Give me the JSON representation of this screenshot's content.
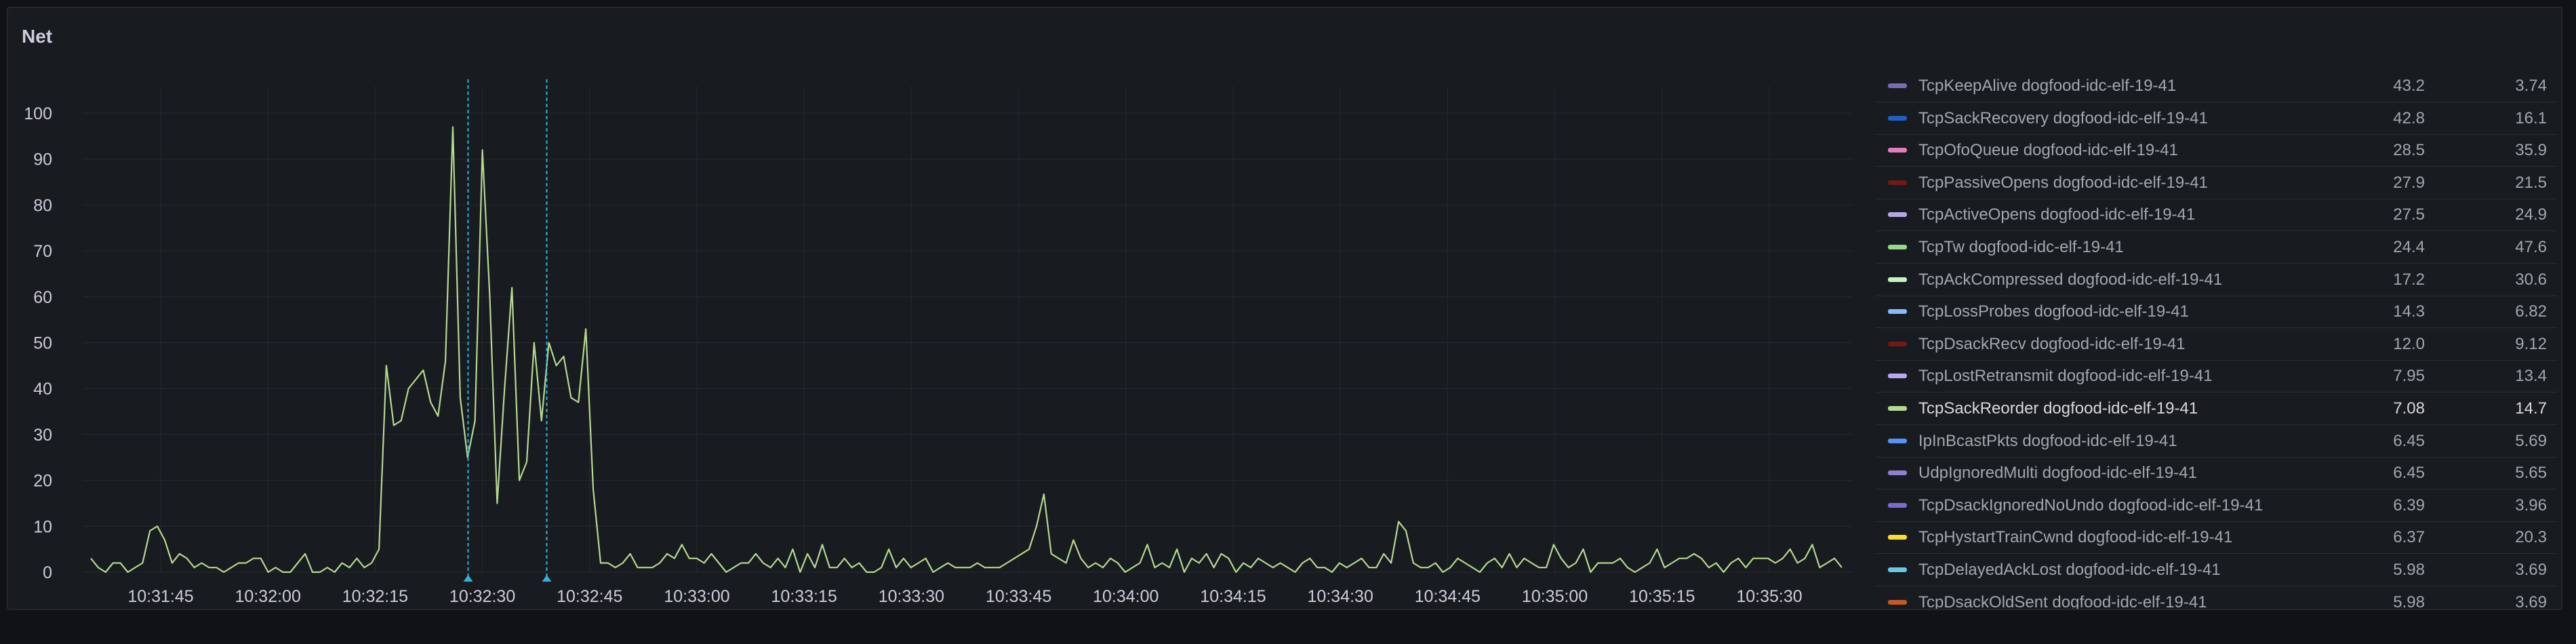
{
  "panel": {
    "title": "Net"
  },
  "chart_data": {
    "type": "line",
    "ylim": [
      0,
      100
    ],
    "yticks": [
      "100",
      "90",
      "80",
      "70",
      "60",
      "50",
      "40",
      "30",
      "20",
      "10",
      "0"
    ],
    "xticks": [
      "10:31:45",
      "10:32:00",
      "10:32:15",
      "10:32:30",
      "10:32:45",
      "10:33:00",
      "10:33:15",
      "10:33:30",
      "10:33:45",
      "10:34:00",
      "10:34:15",
      "10:34:30",
      "10:34:45",
      "10:35:00",
      "10:35:15",
      "10:35:30"
    ],
    "grid": true,
    "annotation_markers": [
      "10:32:28",
      "10:32:39"
    ],
    "series": [
      {
        "name": "TcpSackReorder dogfood-idc-elf-19-41",
        "color": "#b5d991",
        "values": [
          3,
          1,
          0,
          2,
          2,
          0,
          1,
          2,
          9,
          10,
          7,
          2,
          4,
          3,
          1,
          2,
          1,
          1,
          0,
          1,
          2,
          2,
          3,
          3,
          0,
          1,
          0,
          0,
          2,
          4,
          0,
          0,
          1,
          0,
          2,
          1,
          3,
          1,
          2,
          5,
          45,
          32,
          33,
          40,
          42,
          44,
          37,
          34,
          46,
          97,
          38,
          25,
          33,
          92,
          60,
          15,
          40,
          62,
          20,
          24,
          50,
          33,
          50,
          45,
          47,
          38,
          37,
          53,
          18,
          2,
          2,
          1,
          2,
          4,
          1,
          1,
          1,
          2,
          4,
          3,
          6,
          3,
          3,
          2,
          4,
          2,
          0,
          1,
          2,
          2,
          4,
          2,
          1,
          3,
          1,
          5,
          0,
          4,
          1,
          6,
          1,
          1,
          3,
          1,
          2,
          0,
          0,
          1,
          5,
          1,
          3,
          1,
          2,
          3,
          0,
          1,
          2,
          1,
          1,
          1,
          2,
          1,
          1,
          1,
          2,
          3,
          4,
          5,
          10,
          17,
          4,
          3,
          2,
          7,
          3,
          1,
          2,
          1,
          3,
          2,
          0,
          1,
          2,
          6,
          1,
          2,
          1,
          5,
          0,
          3,
          2,
          4,
          1,
          4,
          3,
          0,
          2,
          1,
          3,
          2,
          1,
          2,
          1,
          0,
          2,
          3,
          1,
          1,
          0,
          2,
          1,
          2,
          3,
          1,
          1,
          4,
          2,
          11,
          9,
          2,
          1,
          1,
          2,
          0,
          1,
          3,
          2,
          1,
          0,
          2,
          3,
          1,
          4,
          1,
          3,
          2,
          1,
          1,
          6,
          3,
          1,
          2,
          5,
          0,
          2,
          2,
          2,
          3,
          1,
          0,
          1,
          2,
          5,
          1,
          2,
          3,
          3,
          4,
          3,
          1,
          2,
          0,
          2,
          3,
          1,
          3,
          3,
          3,
          2,
          3,
          5,
          2,
          3,
          6,
          1,
          2,
          3,
          1
        ]
      }
    ]
  },
  "legend": {
    "items": [
      {
        "name": "TcpKeepAlive dogfood-idc-elf-19-41",
        "v1": "43.2",
        "v2": "3.74",
        "color": "#7a6bb5"
      },
      {
        "name": "TcpSackRecovery dogfood-idc-elf-19-41",
        "v1": "42.8",
        "v2": "16.1",
        "color": "#1f60c4"
      },
      {
        "name": "TcpOfoQueue dogfood-idc-elf-19-41",
        "v1": "28.5",
        "v2": "35.9",
        "color": "#e07fbd"
      },
      {
        "name": "TcpPassiveOpens dogfood-idc-elf-19-41",
        "v1": "27.9",
        "v2": "21.5",
        "color": "#6e1a17"
      },
      {
        "name": "TcpActiveOpens dogfood-idc-elf-19-41",
        "v1": "27.5",
        "v2": "24.9",
        "color": "#b5a6e8"
      },
      {
        "name": "TcpTw dogfood-idc-elf-19-41",
        "v1": "24.4",
        "v2": "47.6",
        "color": "#96d98d"
      },
      {
        "name": "TcpAckCompressed dogfood-idc-elf-19-41",
        "v1": "17.2",
        "v2": "30.6",
        "color": "#c8f2c2"
      },
      {
        "name": "TcpLossProbes dogfood-idc-elf-19-41",
        "v1": "14.3",
        "v2": "6.82",
        "color": "#8ab8ff"
      },
      {
        "name": "TcpDsackRecv dogfood-idc-elf-19-41",
        "v1": "12.0",
        "v2": "9.12",
        "color": "#6e1a17"
      },
      {
        "name": "TcpLostRetransmit dogfood-idc-elf-19-41",
        "v1": "7.95",
        "v2": "13.4",
        "color": "#b8a8f0"
      },
      {
        "name": "TcpSackReorder dogfood-idc-elf-19-41",
        "v1": "7.08",
        "v2": "14.7",
        "color": "#b5d991"
      },
      {
        "name": "IpInBcastPkts dogfood-idc-elf-19-41",
        "v1": "6.45",
        "v2": "5.69",
        "color": "#5794f2"
      },
      {
        "name": "UdpIgnoredMulti dogfood-idc-elf-19-41",
        "v1": "6.45",
        "v2": "5.65",
        "color": "#8f7fd4"
      },
      {
        "name": "TcpDsackIgnoredNoUndo dogfood-idc-elf-19-41",
        "v1": "6.39",
        "v2": "3.96",
        "color": "#7a6bd1"
      },
      {
        "name": "TcpHystartTrainCwnd dogfood-idc-elf-19-41",
        "v1": "6.37",
        "v2": "20.3",
        "color": "#fade2a"
      },
      {
        "name": "TcpDelayedAckLost dogfood-idc-elf-19-41",
        "v1": "5.98",
        "v2": "3.69",
        "color": "#6ec6e6"
      },
      {
        "name": "TcpDsackOldSent dogfood-idc-elf-19-41",
        "v1": "5.98",
        "v2": "3.69",
        "color": "#c4572b"
      }
    ]
  }
}
